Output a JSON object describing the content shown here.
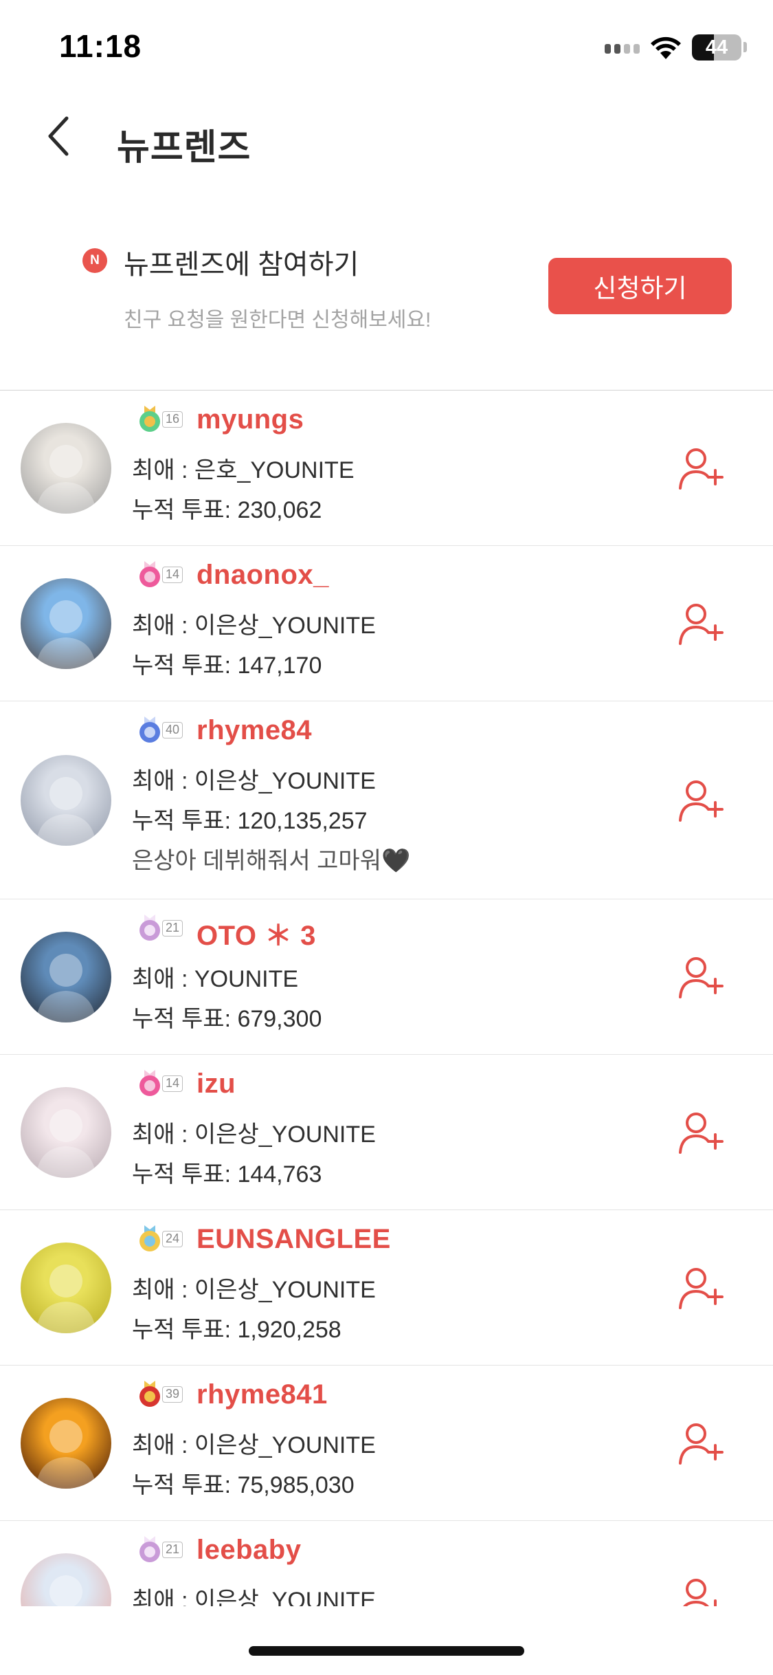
{
  "status_bar": {
    "time": "11:18",
    "battery": "44",
    "battery_level": 0.44
  },
  "header": {
    "title": "뉴프렌즈",
    "back_icon": "chevron-left-icon"
  },
  "join_banner": {
    "badge": "N",
    "title": "뉴프렌즈에 참여하기",
    "subtitle": "친구 요청을 원한다면 신청해보세요!",
    "button_label": "신청하기"
  },
  "colors": {
    "accent": "#e9514b",
    "username": "#e34e48",
    "subtle_text": "#a3a3a3"
  },
  "friends": [
    {
      "level": "16",
      "badge_icon": "green-gear-medal-icon",
      "username": "myungs",
      "favorite": "최애 : 은호_YOUNITE",
      "votes": "누적 투표: 230,062",
      "status": ""
    },
    {
      "level": "14",
      "badge_icon": "pink-gem-medal-icon",
      "username": "dnaonox_",
      "favorite": "최애 : 이은상_YOUNITE",
      "votes": "누적 투표: 147,170",
      "status": ""
    },
    {
      "level": "40",
      "badge_icon": "blue-diamond-emblem-icon",
      "username": "rhyme84",
      "favorite": "최애 : 이은상_YOUNITE",
      "votes": "누적 투표: 120,135,257",
      "status": "은상아 데뷔해줘서 고마워🖤"
    },
    {
      "level": "21",
      "badge_icon": "purple-trophy-icon",
      "username": "OTO ＊ 3",
      "favorite": "최애 : YOUNITE",
      "votes": "누적 투표: 679,300",
      "status": ""
    },
    {
      "level": "14",
      "badge_icon": "pink-gem-medal-icon",
      "username": "izu",
      "favorite": "최애 : 이은상_YOUNITE",
      "votes": "누적 투표: 144,763",
      "status": ""
    },
    {
      "level": "24",
      "badge_icon": "blue-star-medal-icon",
      "username": "EUNSANGLEE",
      "favorite": "최애 : 이은상_YOUNITE",
      "votes": "누적 투표: 1,920,258",
      "status": ""
    },
    {
      "level": "39",
      "badge_icon": "gold-red-emblem-icon",
      "username": "rhyme841",
      "favorite": "최애 : 이은상_YOUNITE",
      "votes": "누적 투표: 75,985,030",
      "status": ""
    },
    {
      "level": "21",
      "badge_icon": "purple-trophy-icon",
      "username": "leebaby",
      "favorite": "최애 : 이은상_YOUNITE",
      "votes": "",
      "status": ""
    }
  ]
}
